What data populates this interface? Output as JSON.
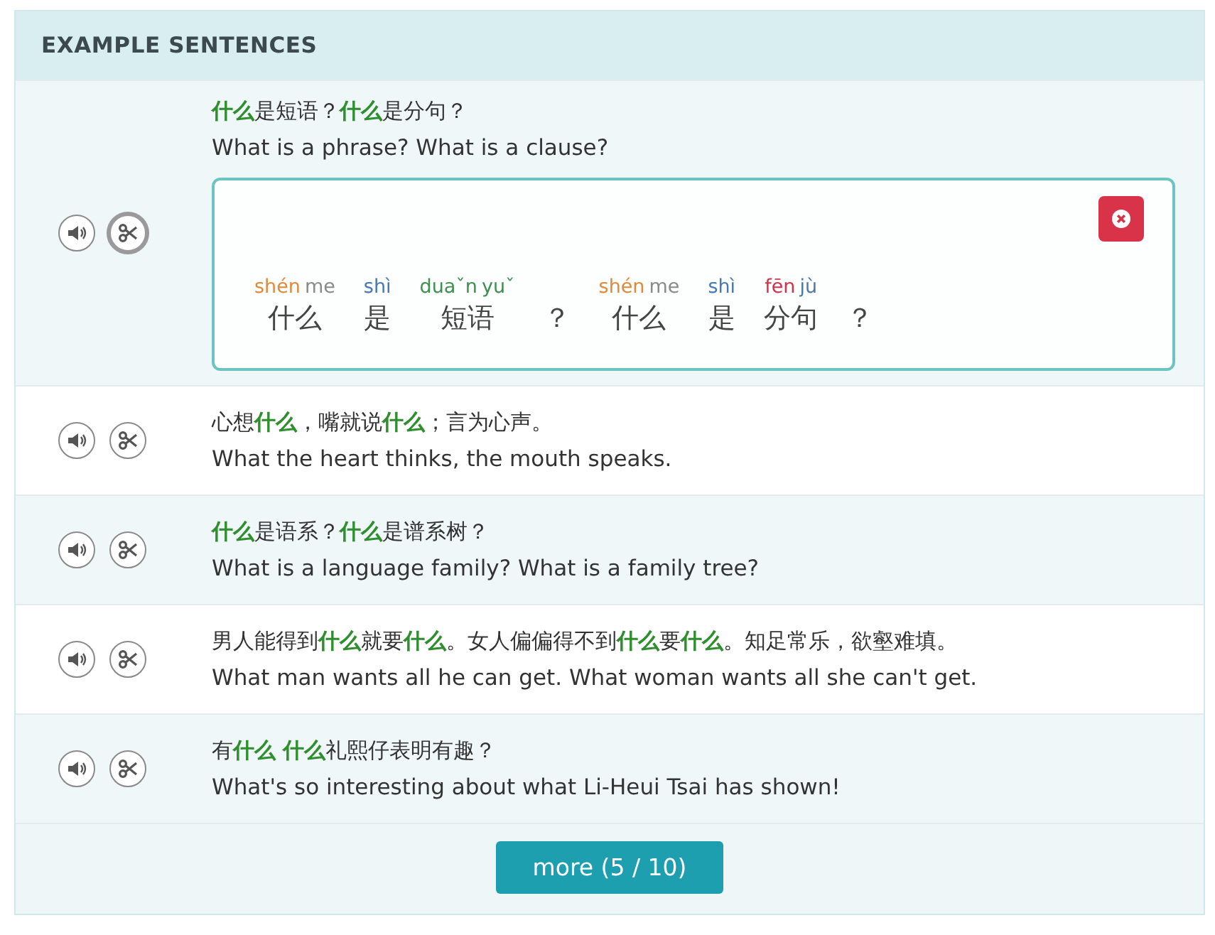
{
  "header": {
    "title": "EXAMPLE SENTENCES"
  },
  "sentences": [
    {
      "chinese": "**什么**是短语？**什么**是分句？",
      "english": "What is a phrase? What is a clause?",
      "split_active": true,
      "breakdown": {
        "words": [
          {
            "syllables": [
              {
                "text": "shén",
                "color": "#e08a3c"
              },
              {
                "text": "me",
                "color": "#8a8a8a"
              }
            ],
            "hanzi": "什么"
          },
          {
            "syllables": [
              {
                "text": "shì",
                "color": "#4a78b0"
              }
            ],
            "hanzi": "是"
          },
          {
            "syllables": [
              {
                "text": "duaˇn",
                "color": "#3f8f4f"
              },
              {
                "text": "yuˇ",
                "color": "#3f8f4f"
              }
            ],
            "hanzi": "短语"
          },
          {
            "hanzi": "？"
          },
          {
            "syllables": [
              {
                "text": "shén",
                "color": "#e08a3c"
              },
              {
                "text": "me",
                "color": "#8a8a8a"
              }
            ],
            "hanzi": "什么"
          },
          {
            "syllables": [
              {
                "text": "shì",
                "color": "#4a78b0"
              }
            ],
            "hanzi": "是"
          },
          {
            "syllables": [
              {
                "text": "fēn",
                "color": "#d0334a"
              },
              {
                "text": "jù",
                "color": "#4a78b0"
              }
            ],
            "hanzi": "分句"
          },
          {
            "hanzi": "？"
          }
        ]
      }
    },
    {
      "chinese": "心想**什么**，嘴就说**什么**；言为心声。",
      "english": "What the heart thinks, the mouth speaks.",
      "split_active": false
    },
    {
      "chinese": "**什么**是语系？**什么**是谱系树？",
      "english": "What is a language family? What is a family tree?",
      "split_active": false
    },
    {
      "chinese": "男人能得到**什么**就要**什么**。女人偏偏得不到**什么**要**什么**。知足常乐，欲壑难填。",
      "english": "What man wants all he can get. What woman wants all she can't get.",
      "split_active": false
    },
    {
      "chinese": "有**什么** **什么**礼熙仔表明有趣？",
      "english": "What's so interesting about what Li-Heui Tsai has shown!",
      "split_active": false
    }
  ],
  "more_button": {
    "label": "more (5 / 10)"
  }
}
